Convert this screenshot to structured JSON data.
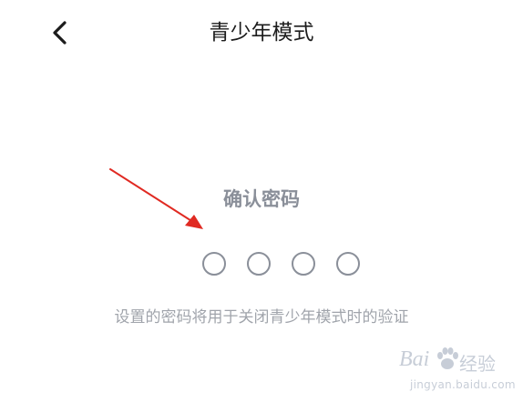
{
  "header": {
    "back_icon": "chevron-left-icon",
    "title": "青少年模式"
  },
  "main": {
    "confirm_title": "确认密码",
    "pin_length": 4,
    "hint": "设置的密码将用于关闭青少年模式时的验证"
  },
  "annotation": {
    "arrow_color": "#e02a22"
  },
  "watermark": {
    "brand": "Bai",
    "brand_suffix": "经验",
    "url": "jingyan.baidu.com"
  },
  "colors": {
    "title": "#1c1c1c",
    "secondary_text": "#8a8f99",
    "hint_text": "#a0a4ab",
    "background": "#ffffff"
  }
}
